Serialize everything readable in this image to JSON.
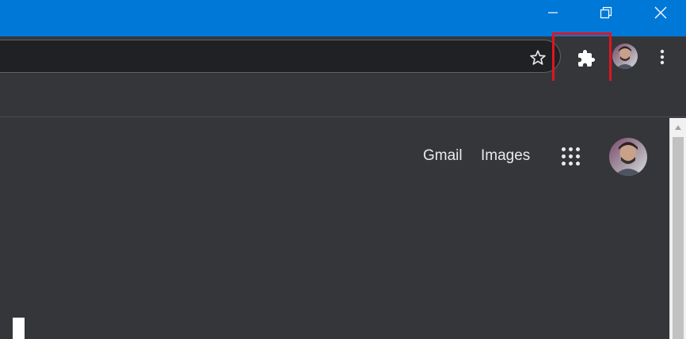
{
  "window_controls": {
    "minimize_icon": "minimize-icon",
    "restore_icon": "restore-icon",
    "close_icon": "close-icon"
  },
  "toolbar": {
    "bookmark_icon": "star-icon",
    "extensions_icon": "puzzle-piece-icon",
    "menu_icon": "three-dots-vertical-icon"
  },
  "google_bar": {
    "gmail_label": "Gmail",
    "images_label": "Images",
    "apps_icon": "apps-grid-icon"
  },
  "colors": {
    "titlebar": "#0078d7",
    "highlight": "#e3141e",
    "page_background": "#35363a",
    "omnibox": "#202124"
  }
}
